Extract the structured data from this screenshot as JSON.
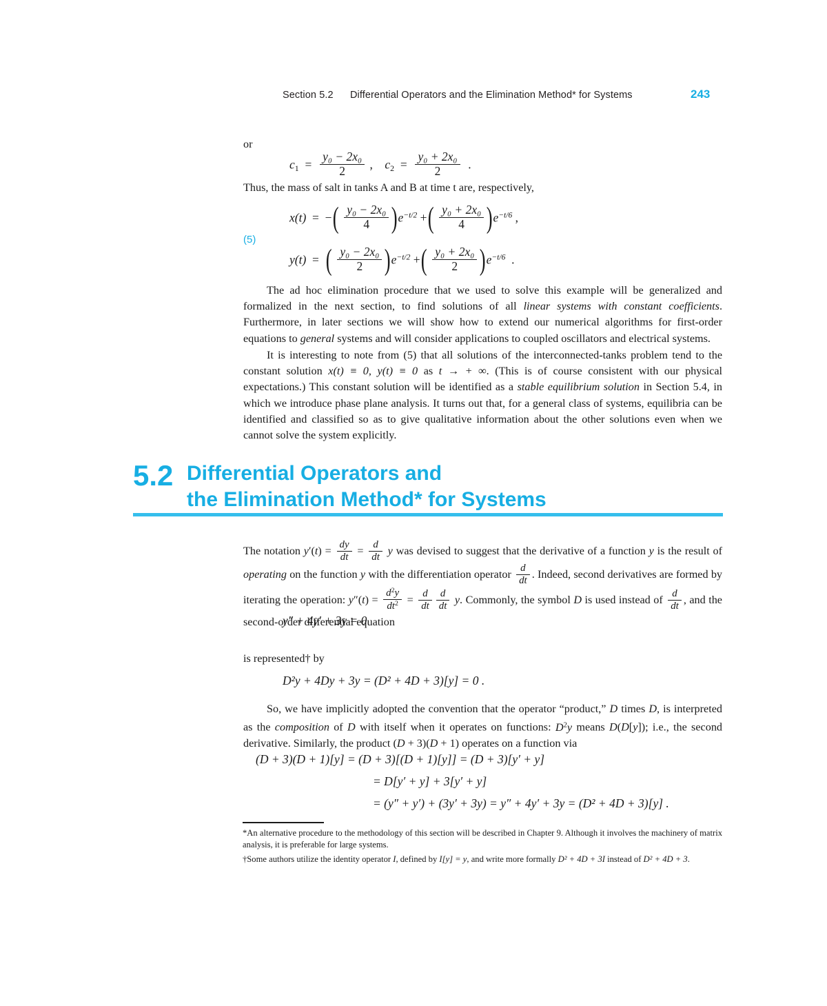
{
  "running_head": {
    "section": "Section 5.2",
    "title": "Differential Operators and the Elimination Method* for Systems",
    "page_number": "243"
  },
  "colors": {
    "accent_blue": "#17AEE3",
    "rule_blue": "#35BEEC",
    "body_text": "#1a1a1a"
  },
  "content": {
    "or_word": "or",
    "thus_line": "Thus, the mass of salt in tanks A and B at time t are, respectively,",
    "equation_label_5": "(5)",
    "para_1": {
      "seg1": "The ad hoc elimination procedure that we used to solve this example will be generalized and formalized in the next section, to find solutions of all ",
      "em1": "linear systems with constant coefficients",
      "seg2": ". Furthermore, in later sections we will show how to extend our numerical algorithms for first-order equations to ",
      "em2": "general",
      "seg3": " systems and will consider applications to coupled oscillators and electrical systems."
    },
    "para_2": {
      "seg1": "It is interesting to note from (5) that all solutions of the interconnected-tanks problem tend to the constant solution ",
      "math1": "x(t) ≡ 0, y(t) ≡ 0",
      "seg2": " as ",
      "math2": "t → + ∞",
      "seg3": ". (This is of course consistent with our physical expectations.) This constant solution will be identified as a ",
      "em1": "stable equilibrium solution",
      "seg4": " in Section 5.4, in which we introduce phase plane analysis. It turns out that, for a general class of systems, equilibria can be identified and classified so as to give qualitative information about the other solutions even when we cannot solve the system explicitly."
    },
    "section_heading": {
      "number": "5.2",
      "line1": "Differential Operators and",
      "line2": "the Elimination Method* for Systems"
    },
    "para_3": {
      "seg1": "The notation ",
      "seg2": " was devised to suggest that the derivative of a function ",
      "seg3": " is the result of ",
      "em1": "operating",
      "seg4": " on the function ",
      "seg5": " with the differentiation operator ",
      "seg6": ". Indeed, second derivatives are formed by iterating the operation: ",
      "seg7": ". Commonly, the symbol ",
      "seg8": " is used instead of ",
      "seg9": ", and the second-order differential equation"
    },
    "represented_line": "is represented† by",
    "para_4": {
      "seg1": "So, we have implicitly adopted the convention that the operator “product,” ",
      "seg2": " times ",
      "seg3": ", is interpreted as the ",
      "em1": "composition",
      "seg4": " of ",
      "seg5": " with itself when it operates on functions: ",
      "seg6": " means ",
      "seg7": "; i.e., the second derivative. Similarly, the product ",
      "seg8": " operates on a function via"
    }
  },
  "equations": {
    "c_constants": {
      "c1_label": "c",
      "c1_sub": "1",
      "c1_num": "y₀ − 2x₀",
      "c1_den": "2",
      "c2_label": "c",
      "c2_sub": "2",
      "c2_num": "y₀ + 2x₀",
      "c2_den": "2"
    },
    "x_of_t": {
      "lhs": "x(t)",
      "term1_num": "y₀ − 2x₀",
      "term1_den": "4",
      "term1_exp": "−t/2",
      "term2_num": "y₀ + 2x₀",
      "term2_den": "4",
      "term2_exp": "−t/6"
    },
    "y_of_t": {
      "lhs": "y(t)",
      "term1_num": "y₀ − 2x₀",
      "term1_den": "2",
      "term1_exp": "−t/2",
      "term2_num": "y₀ + 2x₀",
      "term2_den": "2",
      "term2_exp": "−t/6"
    },
    "ode_second_order": "y″ + 4y′ + 3y = 0",
    "operator_form": "D²y + 4Dy + 3y = (D² + 4D + 3)[y] = 0 .",
    "composition": {
      "line1": "(D + 3)(D + 1)[y]  =  (D + 3)[(D + 1)[y]]  =  (D + 3)[y′ + y]",
      "line2": "=  D[y′ + y] + 3[y′ + y]",
      "line3": "=  (y″ + y′) + (3y′ + 3y)  =  y″ + 4y′ + 3y  =  (D² + 4D + 3)[y] ."
    }
  },
  "footnotes": {
    "star": "*An alternative procedure to the methodology of this section will be described in Chapter 9. Although it involves the machinery of matrix analysis, it is preferable for large systems.",
    "dagger_seg1": "†Some authors utilize the identity operator ",
    "dagger_I": "I",
    "dagger_seg2": ", defined by ",
    "dagger_math1": "I[y] = y",
    "dagger_seg3": ", and write more formally ",
    "dagger_math2": "D² + 4D + 3I",
    "dagger_seg4": " instead of ",
    "dagger_math3": "D² + 4D + 3",
    "dagger_seg5": "."
  }
}
